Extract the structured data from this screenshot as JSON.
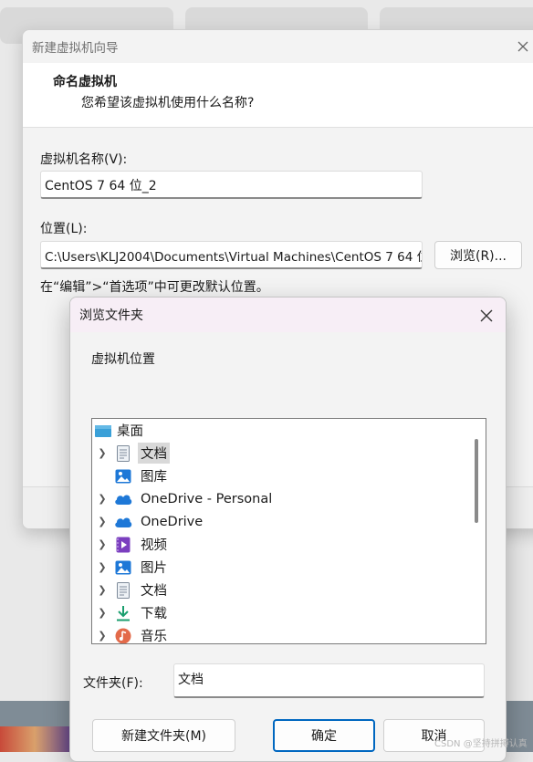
{
  "wizard": {
    "title": "新建虚拟机向导",
    "header_title": "命名虚拟机",
    "header_subtitle": "您希望该虚拟机使用什么名称?",
    "name_label": "虚拟机名称(V):",
    "name_value": "CentOS 7 64 位_2",
    "location_label": "位置(L):",
    "location_value": "C:\\Users\\KLJ2004\\Documents\\Virtual Machines\\CentOS 7 64 位",
    "browse_label": "浏览(R)...",
    "hint": "在“编辑”>“首选项”中可更改默认位置。"
  },
  "browse_dialog": {
    "title": "浏览文件夹",
    "description": "虚拟机位置",
    "tree_items": [
      {
        "label": "桌面",
        "icon": "desktop-icon",
        "expandable": false,
        "selected": false,
        "root": true
      },
      {
        "label": "文档",
        "icon": "document-icon",
        "expandable": true,
        "selected": true
      },
      {
        "label": "图库",
        "icon": "gallery-icon",
        "expandable": false,
        "selected": false
      },
      {
        "label": "OneDrive - Personal",
        "icon": "cloud-icon",
        "expandable": true,
        "selected": false
      },
      {
        "label": "OneDrive",
        "icon": "cloud-icon",
        "expandable": true,
        "selected": false
      },
      {
        "label": "视频",
        "icon": "video-icon",
        "expandable": true,
        "selected": false
      },
      {
        "label": "图片",
        "icon": "picture-icon",
        "expandable": true,
        "selected": false
      },
      {
        "label": "文档",
        "icon": "document-icon",
        "expandable": true,
        "selected": false
      },
      {
        "label": "下载",
        "icon": "download-icon",
        "expandable": true,
        "selected": false
      },
      {
        "label": "音乐",
        "icon": "music-icon",
        "expandable": true,
        "selected": false
      }
    ],
    "folder_label": "文件夹(F):",
    "folder_value": "文档",
    "new_folder_button": "新建文件夹(M)",
    "ok_button": "确定",
    "cancel_button": "取消"
  },
  "watermark": "CSDN @坚持拼搏认真",
  "colors": {
    "dialog_titlebar": "#f7eef6",
    "ok_border": "#0067c0",
    "cloud": "#1e78d7",
    "download": "#1a9e6e"
  }
}
